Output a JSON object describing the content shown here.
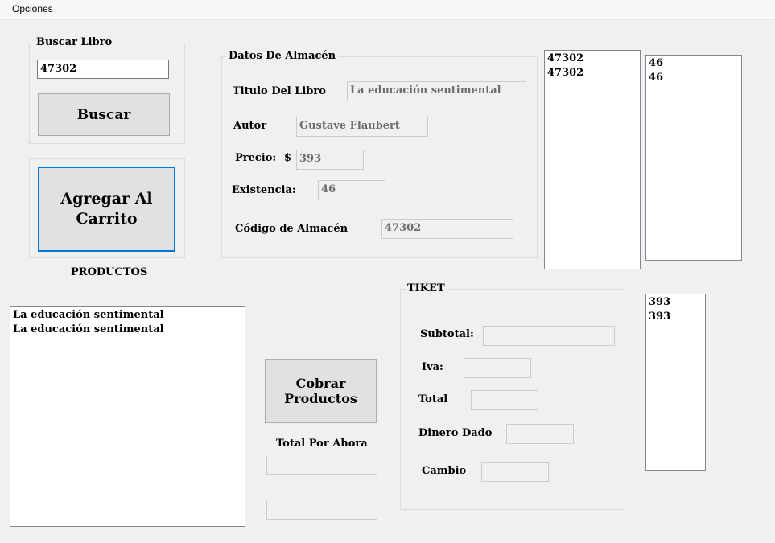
{
  "menu": {
    "options_label": "Opciones"
  },
  "search": {
    "group_title": "Buscar Libro",
    "input_value": "47302",
    "button_label": "Buscar"
  },
  "cart": {
    "add_button_label": "Agregar Al Carrito"
  },
  "products": {
    "label": "PRODUCTOS",
    "items": [
      "La educación sentimental",
      "La educación sentimental"
    ]
  },
  "warehouse": {
    "group_title": "Datos De Almacén",
    "title_label": "Titulo Del Libro",
    "title_value": "La educación sentimental",
    "author_label": "Autor",
    "author_value": "Gustave Flaubert",
    "price_label": "Precio:",
    "currency_symbol": "$",
    "price_value": "393",
    "stock_label": "Existencia:",
    "stock_value": "46",
    "code_label": "Código de Almacén",
    "code_value": "47302"
  },
  "lists": {
    "codes": [
      "47302",
      "47302"
    ],
    "stocks": [
      "46",
      "46"
    ],
    "prices": [
      "393",
      "393"
    ]
  },
  "checkout": {
    "charge_button_label": "Cobrar Productos",
    "total_so_far_label": "Total Por Ahora",
    "total_so_far_value": "",
    "extra_value": ""
  },
  "ticket": {
    "group_title": "TIKET",
    "subtotal_label": "Subtotal:",
    "subtotal_value": "",
    "iva_label": "Iva:",
    "iva_value": "",
    "total_label": "Total",
    "total_value": "",
    "cash_label": "Dinero Dado",
    "cash_value": "",
    "change_label": "Cambio",
    "change_value": ""
  }
}
